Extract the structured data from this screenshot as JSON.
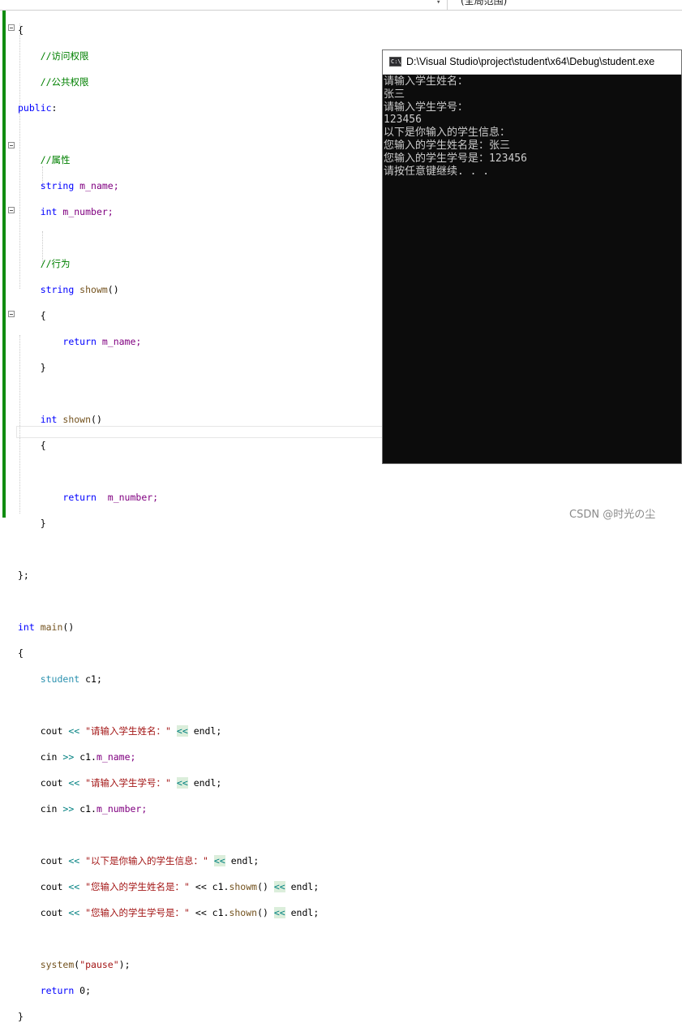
{
  "toolbar": {
    "scope_label": "(全局范围)"
  },
  "code": {
    "l01": "{",
    "l02": "//访问权限",
    "l03": "//公共权限",
    "l04_kw": "public",
    "l04_rest": ":",
    "l06": "//属性",
    "l07_ty": "string",
    "l07_var": " m_name;",
    "l08_ty": "int",
    "l08_var": " m_number;",
    "l10": "//行为",
    "l11_ty": "string",
    "l11_fn": " showm",
    "l11_rest": "()",
    "l12": "{",
    "l13_kw": "return",
    "l13_rest": " m_name;",
    "l14": "}",
    "l16_ty": "int",
    "l16_fn": " shown",
    "l16_rest": "()",
    "l17": "{",
    "l19_kw": "return",
    "l19_rest": "  m_number;",
    "l20": "}",
    "l22": "};",
    "l24_ty": "int",
    "l24_fn": " main",
    "l24_rest": "()",
    "l25": "{",
    "l26_ty": "student",
    "l26_var": " c1;",
    "l28_a": "cout ",
    "l28_op": "<<",
    "l28_str": " \"请输入学生姓名：\"",
    "l28_hl": "<<",
    "l28_end": " endl;",
    "l29_a": "cin ",
    "l29_op": ">>",
    "l29_b": " c1.",
    "l29_c": "m_name;",
    "l30_a": "cout ",
    "l30_op": "<<",
    "l30_str": " \"请输入学生学号：\"",
    "l30_hl": "<<",
    "l30_end": " endl;",
    "l31_a": "cin ",
    "l31_op": ">>",
    "l31_b": " c1.",
    "l31_c": "m_number;",
    "l33_a": "cout ",
    "l33_op": "<<",
    "l33_str": " \"以下是你输入的学生信息：\"",
    "l33_hl": "<<",
    "l33_end": " endl;",
    "l34_a": "cout ",
    "l34_op": "<<",
    "l34_str": " \"您输入的学生姓名是：\"",
    "l34_mid": " << c1.",
    "l34_fn": "showm",
    "l34_paren": "() ",
    "l34_hl": "<<",
    "l34_end": " endl;",
    "l35_a": "cout ",
    "l35_op": "<<",
    "l35_str": " \"您输入的学生学号是：\"",
    "l35_mid": " << c1.",
    "l35_fn": "shown",
    "l35_paren": "() ",
    "l35_hl": "<<",
    "l35_end": " endl;",
    "l37_fn": "system",
    "l37_a": "(",
    "l37_str": "\"pause\"",
    "l37_b": ");",
    "l38_kw": "return",
    "l38_rest": " 0;",
    "l39": "}"
  },
  "console": {
    "title": "D:\\Visual Studio\\project\\student\\x64\\Debug\\student.exe",
    "icon_text": "C:\\",
    "lines": [
      "请输入学生姓名：",
      "张三",
      "请输入学生学号：",
      "123456",
      "以下是你输入的学生信息：",
      "您输入的学生姓名是：张三",
      "您输入的学生学号是：123456",
      "请按任意键继续. . ."
    ]
  },
  "watermark": "CSDN @时光の尘",
  "colors": {
    "keyword": "#0000ff",
    "type": "#2b91af",
    "comment": "#008000",
    "string": "#a31515",
    "change_bar": "#108c10",
    "console_bg": "#0c0c0c"
  }
}
